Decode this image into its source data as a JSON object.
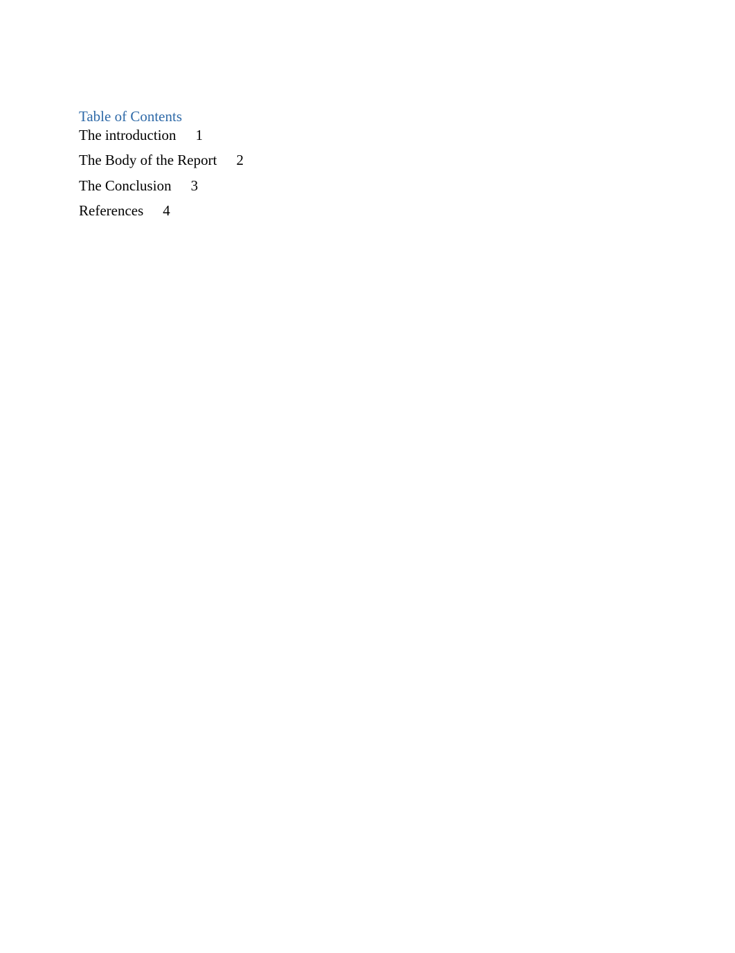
{
  "toc": {
    "heading": "Table of Contents",
    "entries": [
      {
        "title": "The introduction",
        "page": "1"
      },
      {
        "title": "The Body of the Report",
        "page": "2"
      },
      {
        "title": "The Conclusion",
        "page": "3"
      },
      {
        "title": "References",
        "page": "4"
      }
    ]
  }
}
